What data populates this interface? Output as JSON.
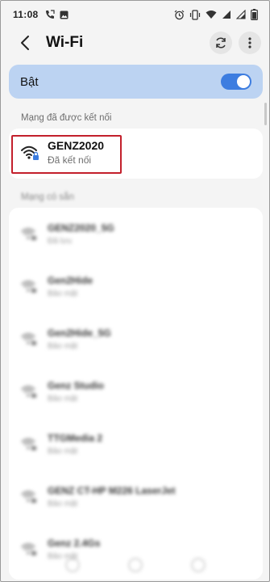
{
  "status_bar": {
    "time": "11:08",
    "left_icons": [
      "call-forward-icon",
      "image-icon"
    ],
    "right_icons": [
      "alarm-icon",
      "vibrate-icon",
      "wifi-icon",
      "signal-icon",
      "signal-icon",
      "battery-icon"
    ]
  },
  "header": {
    "title": "Wi-Fi",
    "back_icon": "back-arrow-icon",
    "refresh_icon": "refresh-icon",
    "more_icon": "more-vertical-icon"
  },
  "wifi_toggle": {
    "label": "Bật",
    "on": true,
    "accent": "#3d7de0",
    "background": "#bcd3f2"
  },
  "connected_section": {
    "label": "Mạng đã được kết nối",
    "network": {
      "name": "GENZ2020",
      "status": "Đã kết nối",
      "icon": "wifi-locked-icon"
    },
    "highlight_color": "#c3202c"
  },
  "available_section": {
    "label": "Mạng có sẵn",
    "networks": [
      {
        "name": "GENZ2020_5G",
        "status": "Đã lưu"
      },
      {
        "name": "Gen2Hide",
        "status": "Bảo mật"
      },
      {
        "name": "Gen2Hide_5G",
        "status": "Bảo mật"
      },
      {
        "name": "Genz Studio",
        "status": "Bảo mật"
      },
      {
        "name": "TTGMedia 2",
        "status": "Bảo mật"
      },
      {
        "name": "GENZ CT-HP M226 LaserJet",
        "status": "Bảo mật"
      },
      {
        "name": "Genz 2.4Gs",
        "status": "Bảo mật"
      }
    ]
  }
}
